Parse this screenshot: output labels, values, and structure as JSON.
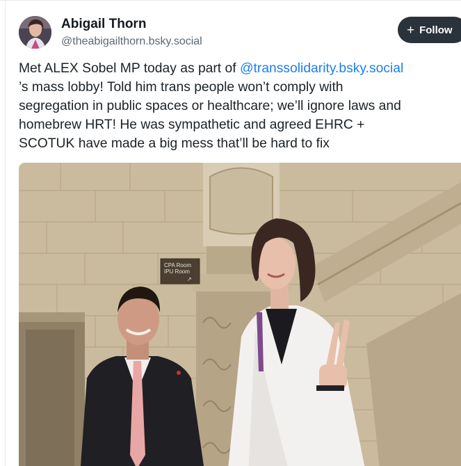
{
  "post": {
    "author": {
      "display_name": "Abigail Thorn",
      "handle": "@theabigailthorn.bsky.social"
    },
    "follow_button": {
      "icon": "plus-icon",
      "label": "Follow"
    },
    "text": {
      "line1_before": "Met ALEX Sobel MP today as part of ",
      "mention": "@transsolidarity.bsky.social",
      "line2": "’s mass lobby! Told him trans people won’t comply with",
      "line3": "segregation in public spaces or healthcare; we’ll ignore laws and",
      "line4": "homebrew HRT! He was sympathetic and agreed EHRC +",
      "line5": "SCOTUK have made a big mess that’ll be hard to fix"
    },
    "image": {
      "sign_line1": "CPA Room",
      "sign_line2": "IPU Room",
      "sign_arrow": "↗"
    }
  },
  "colors": {
    "follow_bg": "#2a333c",
    "mention": "#1b7ff0",
    "text": "#1a2126",
    "handle": "#5b6873"
  }
}
